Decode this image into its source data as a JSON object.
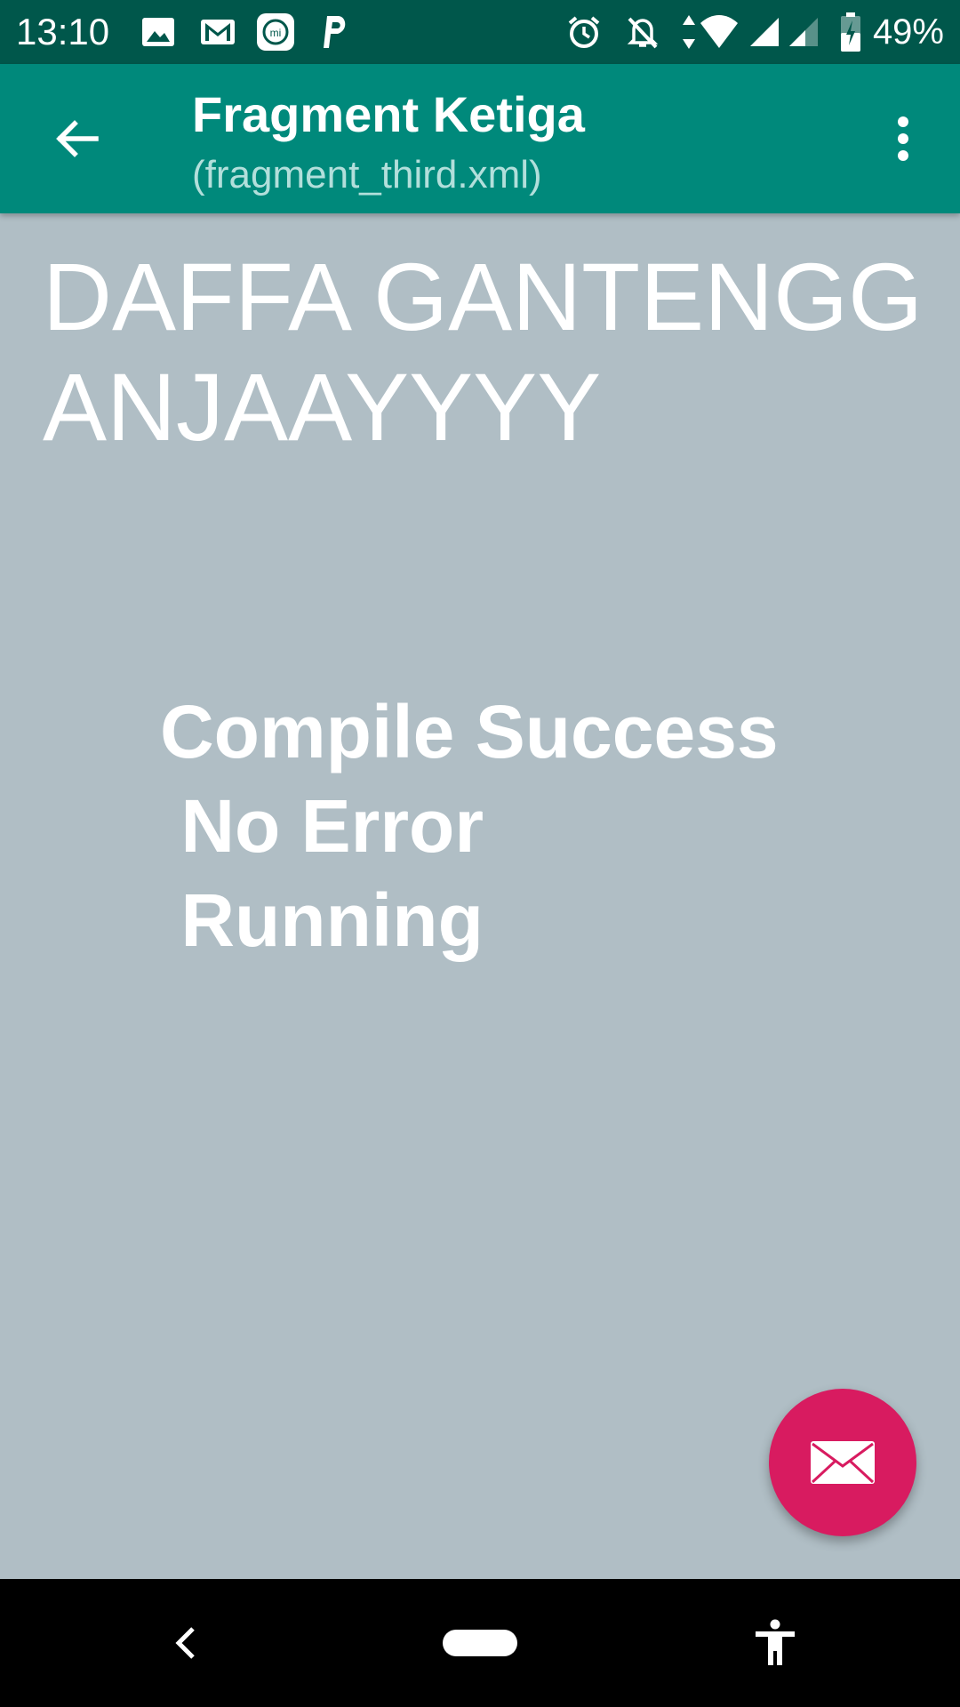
{
  "status_bar": {
    "time": "13:10",
    "battery_percent": "49%",
    "notification_icons": [
      "image-icon",
      "gmail-icon",
      "mi-icon",
      "parking-p-icon"
    ],
    "system_icons": [
      "alarm-icon",
      "bell-off-icon",
      "data-arrows-icon",
      "wifi-icon",
      "signal-icon",
      "signal-weak-icon",
      "battery-charging-icon"
    ],
    "background_color": "#00574b"
  },
  "app_bar": {
    "title": "Fragment Ketiga",
    "subtitle": "(fragment_third.xml)",
    "background_color": "#00897b"
  },
  "content": {
    "heading": "DAFFA GANTENGG\nANJAAYYYY",
    "status_lines": "Compile Success\n No Error\n Running",
    "background_color": "#b0bec5"
  },
  "fab": {
    "icon": "envelope-icon",
    "color": "#d81b60"
  },
  "nav_bar": {
    "buttons": [
      "back-icon",
      "home-pill-icon",
      "accessibility-icon"
    ]
  }
}
